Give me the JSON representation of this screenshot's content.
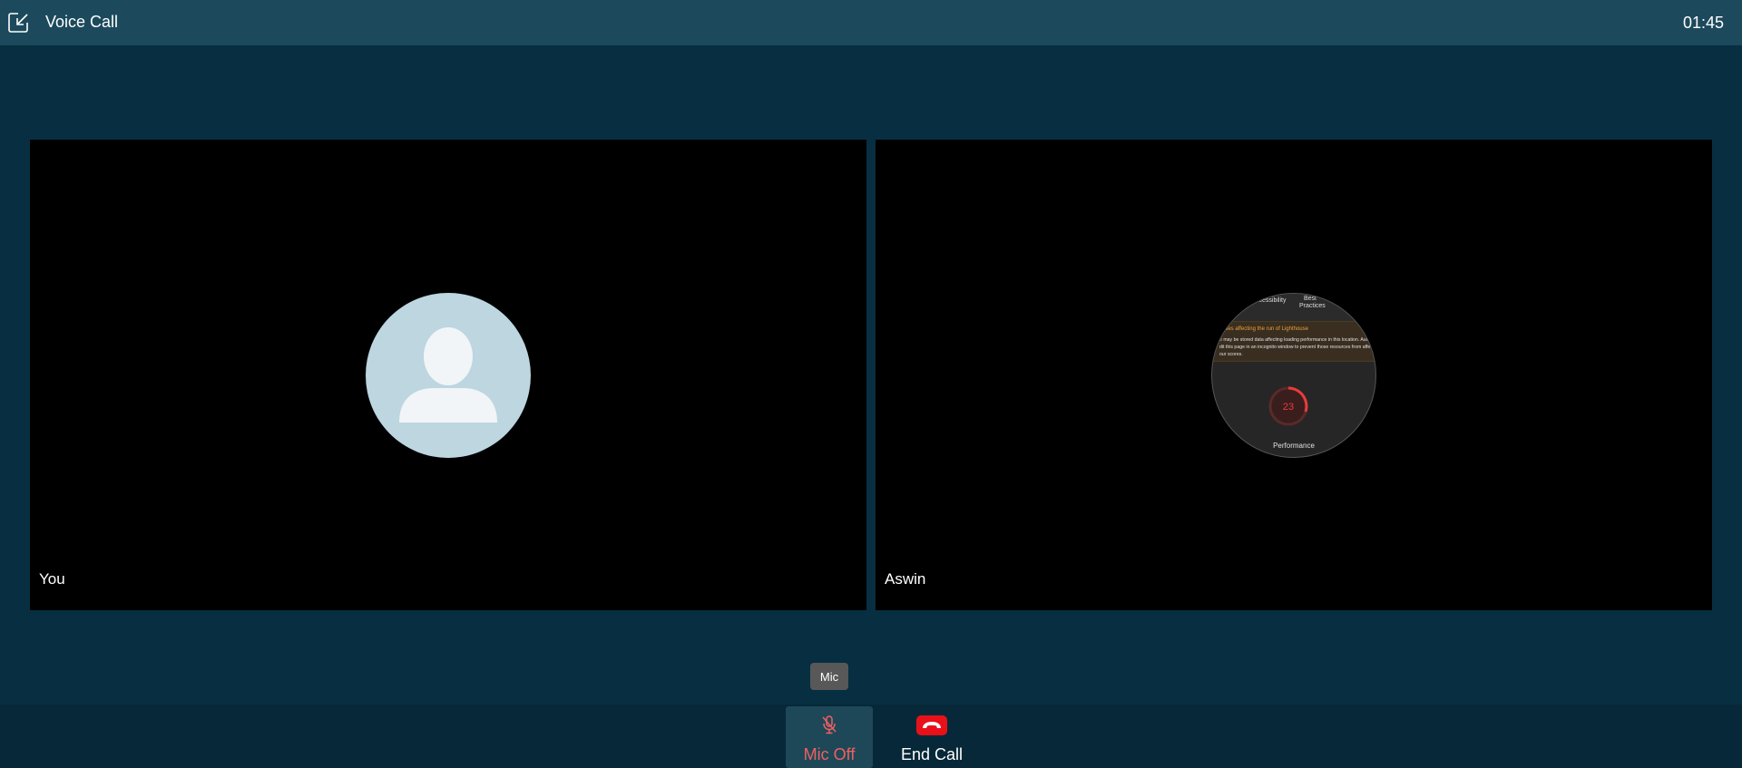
{
  "header": {
    "title": "Voice Call",
    "timer": "01:45",
    "minimize_icon": "minimize-window-icon"
  },
  "participants": [
    {
      "name": "You",
      "avatar": "default-user-avatar"
    },
    {
      "name": "Aswin",
      "avatar": "screen-share-thumbnail",
      "screen_preview": {
        "tab1": "ccessibility",
        "tab2": "Best Practices",
        "warning_title": "ssues affecting the run of Lighthouse",
        "warning_line1": "e may be stored data affecting loading performance in this location. Aud",
        "warning_line2": "dit this page in an incognito window to prevent those resources from affec",
        "warning_line3": "our scores.",
        "score": "23",
        "score_label": "Performance"
      }
    }
  ],
  "tooltip": {
    "text": "Mic"
  },
  "controls": {
    "mic_label": "Mic Off",
    "end_label": "End Call"
  },
  "colors": {
    "background": "#072f41",
    "header": "#1c4a5c",
    "end_call": "#e8111a",
    "mic_off": "#f06060"
  }
}
